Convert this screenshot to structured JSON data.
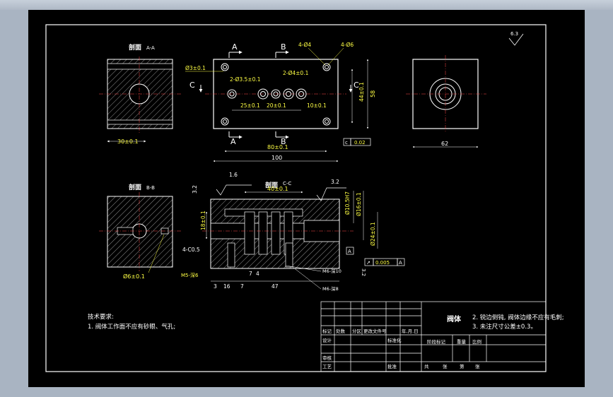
{
  "views": {
    "section_aa": {
      "title": "剖面",
      "code": "A-A",
      "dim_bottom": "30±0.1"
    },
    "front": {
      "cut_a": "A",
      "cut_b": "B",
      "cut_c": "C",
      "d_3": "Ø3±0.1",
      "d_35": "2-Ø3.5±0.1",
      "d_4": "2-Ø4±0.1",
      "holes_a": "4-Ø4",
      "holes_b": "4-Ø6",
      "d25": "25±0.1",
      "d20": "20±0.1",
      "d10": "10±0.1",
      "d44": "44±0.1",
      "d58": "58",
      "d80": "80±0.1",
      "d100": "100",
      "flatness_sym": "c",
      "flatness_val": "0.02"
    },
    "side": {
      "dim_bottom": "62"
    },
    "section_bb": {
      "title": "剖面",
      "code": "B-B",
      "dim_bottom": "Ø6±0.1"
    },
    "section_cc": {
      "title": "剖面",
      "code": "C-C",
      "rough_1": "1.6",
      "rough_2": "3.2",
      "rough_3": "3.2",
      "rough_4": "3.2",
      "d40": "40±0.1",
      "d18": "18±0.1",
      "dia_10": "Ø10.5H7",
      "dia_16": "Ø16±0.1",
      "dia_24": "Ø24±0.1",
      "chamfer": "4-C0.5",
      "thread_m5": "M5-深6",
      "thread_m6a": "M6-深10",
      "thread_m6b": "M6-深8",
      "datum": "A",
      "runout_sym": "↗",
      "runout_val": "0.005",
      "runout_ref": "A",
      "b3": "3",
      "b16": "16",
      "b7": "7",
      "b7b": "7",
      "b4": "4",
      "b47": "47"
    },
    "roughness_corner": "6.3"
  },
  "notes": {
    "heading": "技术要求:",
    "line1": "1. 阀体工作面不应有砂眼、气孔;",
    "line2": "2. 锐边倒钝, 阀体边缘不应有毛刺;",
    "line3": "3. 未注尺寸公差±0.3。"
  },
  "title_block": {
    "part_name": "阀体",
    "h_mark": "标记",
    "h_count": "处数",
    "h_zone": "分区",
    "h_docno": "更改文件号",
    "h_date": "年.月.日",
    "h_design": "设计",
    "h_std": "标准化",
    "h_review": "审核",
    "h_process": "工艺",
    "h_approve": "批准",
    "h_stage": "阶段标记",
    "h_weight": "重量",
    "h_scale": "比例",
    "h_total": "共",
    "h_sheets": "张",
    "h_no": "第",
    "h_sheet": "张"
  }
}
